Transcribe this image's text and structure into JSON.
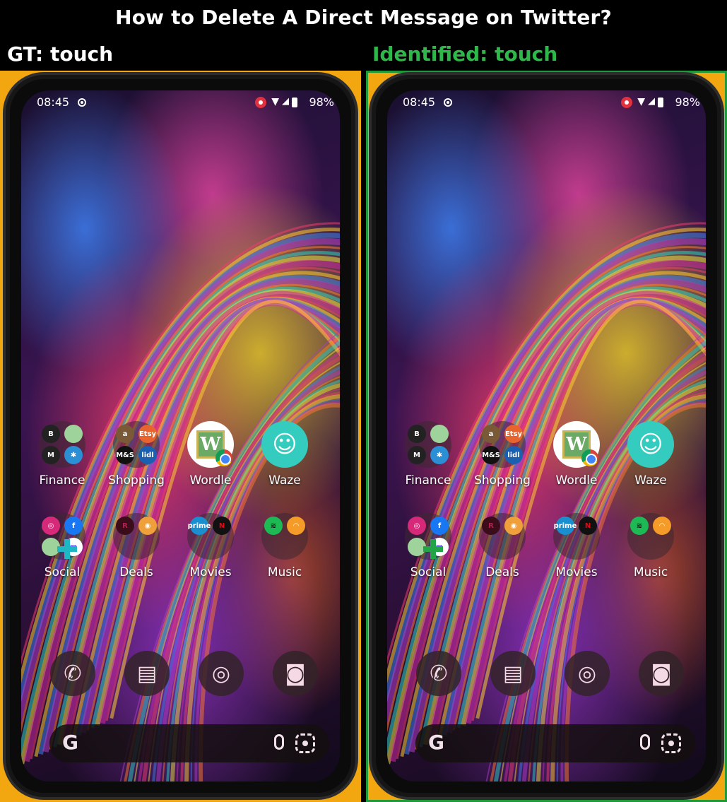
{
  "title": "How to Delete A Direct Message on Twitter?",
  "panels": {
    "left": {
      "label": "GT: touch"
    },
    "right": {
      "label": "Identified: touch"
    }
  },
  "colors": {
    "panel_bg": "#f2a60f",
    "identified_label": "#2fb84a",
    "identified_border": "#1f9a3b",
    "gt_marker": "#1eb7c4",
    "identified_marker": "#22a447"
  },
  "phone": {
    "status_bar": {
      "time": "08:45",
      "battery": "98%"
    },
    "apps_row1": [
      {
        "label": "Finance",
        "type": "folder",
        "minis": [
          "B",
          "",
          "M",
          "✱"
        ]
      },
      {
        "label": "Shopping",
        "type": "folder",
        "minis": [
          "a",
          "Etsy",
          "M&S",
          "lidl"
        ]
      },
      {
        "label": "Wordle",
        "type": "wordle",
        "glyph": "W"
      },
      {
        "label": "Waze",
        "type": "waze",
        "glyph": "☺"
      }
    ],
    "apps_row2": [
      {
        "label": "Social",
        "type": "folder",
        "minis": [
          "◎",
          "f",
          "",
          "m"
        ]
      },
      {
        "label": "Deals",
        "type": "folder",
        "minis": [
          "R",
          "◉"
        ]
      },
      {
        "label": "Movies",
        "type": "folder",
        "minis": [
          "prime",
          "N"
        ]
      },
      {
        "label": "Music",
        "type": "folder",
        "minis": [
          "≋",
          "◠"
        ]
      }
    ],
    "dock": [
      {
        "name": "phone",
        "glyph": "✆"
      },
      {
        "name": "messages",
        "glyph": "▤"
      },
      {
        "name": "chrome",
        "glyph": "◎"
      },
      {
        "name": "camera",
        "glyph": "◙"
      }
    ],
    "search": {
      "logo": "G"
    }
  }
}
